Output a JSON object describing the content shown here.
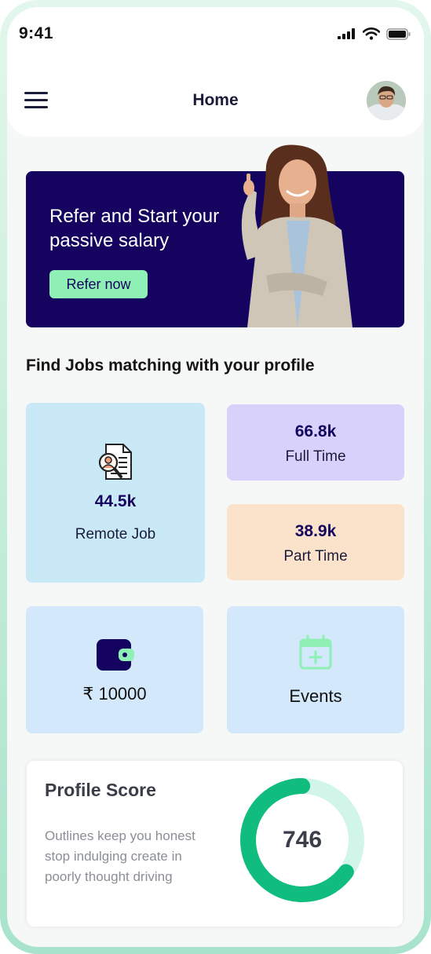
{
  "status": {
    "time": "9:41"
  },
  "header": {
    "title": "Home"
  },
  "banner": {
    "title": "Refer and Start your passive salary",
    "button": "Refer now"
  },
  "jobs": {
    "heading": "Find Jobs matching with your profile",
    "remote": {
      "count": "44.5k",
      "label": "Remote Job",
      "icon": "document-search-icon"
    },
    "full_time": {
      "count": "66.8k",
      "label": "Full Time"
    },
    "part_time": {
      "count": "38.9k",
      "label": "Part Time"
    }
  },
  "wallet": {
    "amount": "₹ 10000",
    "icon": "wallet-icon"
  },
  "events": {
    "label": "Events",
    "icon": "calendar-plus-icon"
  },
  "profile_score": {
    "title": "Profile Score",
    "description": "Outlines keep you honest stop indulging create in poorly thought driving",
    "value": "746",
    "fraction": 0.65
  },
  "colors": {
    "brand": "#15045f",
    "accent": "#8ef0b4",
    "progress": "#10bd7f",
    "progress_track": "#d2f5e9"
  }
}
